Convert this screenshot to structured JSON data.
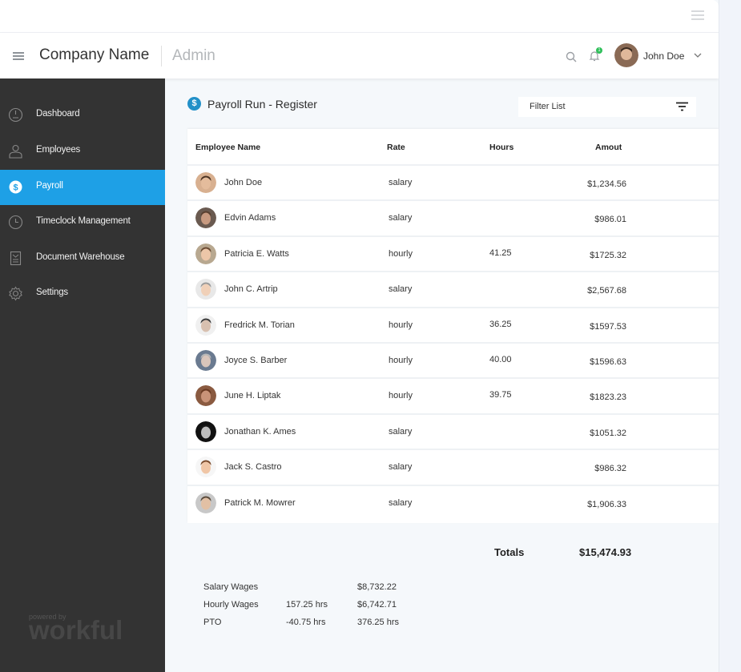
{
  "header": {
    "company": "Company Name",
    "section": "Admin",
    "notification_count": "1",
    "user": "John Doe"
  },
  "sidebar": {
    "items": [
      {
        "label": "Dashboard",
        "icon": "dashboard-icon",
        "active": false
      },
      {
        "label": "Employees",
        "icon": "employees-icon",
        "active": false
      },
      {
        "label": "Payroll",
        "icon": "dollar-icon",
        "active": true
      },
      {
        "label": "Timeclock Management",
        "icon": "clock-icon",
        "active": false
      },
      {
        "label": "Document Warehouse",
        "icon": "document-icon",
        "active": false
      },
      {
        "label": "Settings",
        "icon": "gear-icon",
        "active": false
      }
    ],
    "powered_by": "powered by",
    "brand": "workful"
  },
  "main": {
    "title": "Payroll Run - Register",
    "filter_label": "Filter List",
    "columns": [
      "Employee Name",
      "Rate",
      "Hours",
      "Amout"
    ],
    "rows": [
      {
        "name": "John Doe",
        "rate": "salary",
        "hours": "",
        "amount": "$1,234.56"
      },
      {
        "name": "Edvin Adams",
        "rate": "salary",
        "hours": "",
        "amount": "$986.01"
      },
      {
        "name": "Patricia E. Watts",
        "rate": "hourly",
        "hours": "41.25",
        "amount": "$1725.32"
      },
      {
        "name": "John C. Artrip",
        "rate": "salary",
        "hours": "",
        "amount": "$2,567.68"
      },
      {
        "name": "Fredrick M. Torian",
        "rate": "hourly",
        "hours": "36.25",
        "amount": "$1597.53"
      },
      {
        "name": "Joyce S. Barber",
        "rate": "hourly",
        "hours": "40.00",
        "amount": "$1596.63"
      },
      {
        "name": "June H. Liptak",
        "rate": "hourly",
        "hours": "39.75",
        "amount": "$1823.23"
      },
      {
        "name": "Jonathan K. Ames",
        "rate": "salary",
        "hours": "",
        "amount": "$1051.32"
      },
      {
        "name": "Jack S. Castro",
        "rate": "salary",
        "hours": "",
        "amount": "$986.32"
      },
      {
        "name": "Patrick M. Mowrer",
        "rate": "salary",
        "hours": "",
        "amount": "$1,906.33"
      }
    ],
    "totals_label": "Totals",
    "totals_value": "$15,474.93",
    "summary": [
      {
        "label": "Salary Wages",
        "hours": "",
        "value": "$8,732.22"
      },
      {
        "label": "Hourly Wages",
        "hours": "157.25 hrs",
        "value": "$6,742.71"
      },
      {
        "label": "PTO",
        "hours": "-40.75 hrs",
        "value": "376.25 hrs"
      }
    ]
  },
  "colors": {
    "accent": "#1ea0e6",
    "sidebar_bg": "#333333",
    "badge": "#2fbf5a"
  }
}
